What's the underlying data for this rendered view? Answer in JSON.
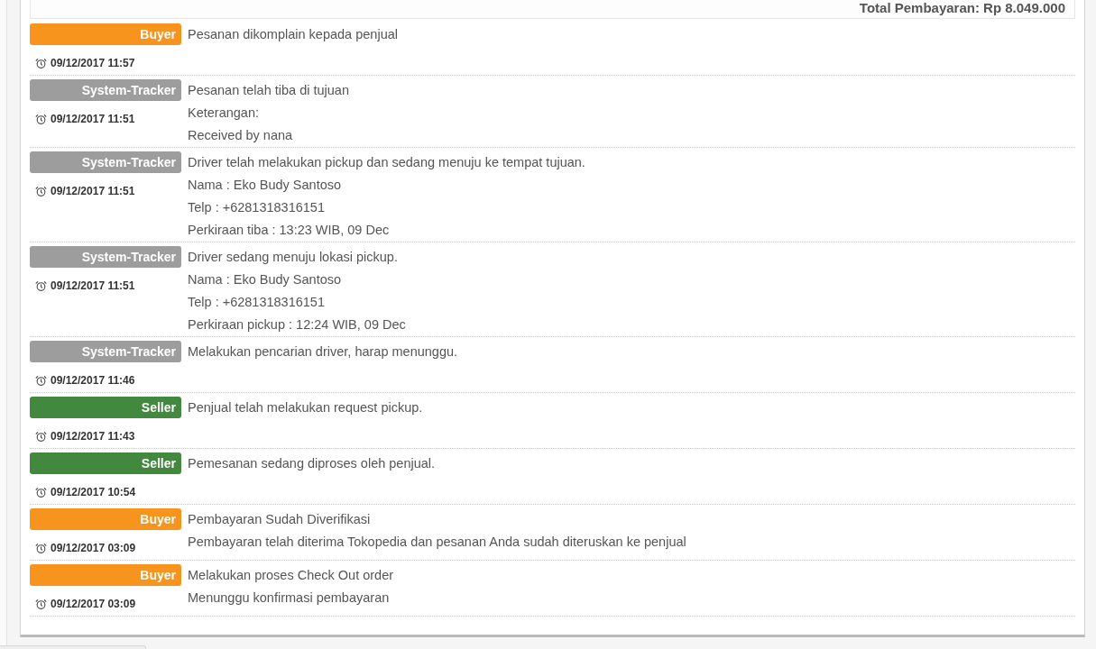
{
  "summary": {
    "total": "Total Pembayaran: Rp 8.049.000"
  },
  "history": [
    {
      "actor": "Buyer",
      "color": "#f7941d",
      "time": "09/12/2017 11:57",
      "lines": [
        "Pesanan dikomplain kepada penjual"
      ]
    },
    {
      "actor": "System-Tracker",
      "color": "#9d9d9d",
      "time": "09/12/2017 11:51",
      "lines": [
        "Pesanan telah tiba di tujuan",
        "Keterangan:",
        "Received by nana"
      ]
    },
    {
      "actor": "System-Tracker",
      "color": "#9d9d9d",
      "time": "09/12/2017 11:51",
      "lines": [
        "Driver telah melakukan pickup dan sedang menuju ke tempat tujuan.",
        "Nama : Eko Budy Santoso",
        "Telp : +6281318316151",
        "Perkiraan tiba : 13:23 WIB, 09 Dec"
      ]
    },
    {
      "actor": "System-Tracker",
      "color": "#9d9d9d",
      "time": "09/12/2017 11:51",
      "lines": [
        "Driver sedang menuju lokasi pickup.",
        "Nama : Eko Budy Santoso",
        "Telp : +6281318316151",
        "Perkiraan pickup : 12:24 WIB, 09 Dec"
      ]
    },
    {
      "actor": "System-Tracker",
      "color": "#9d9d9d",
      "time": "09/12/2017 11:46",
      "lines": [
        "Melakukan pencarian driver, harap menunggu."
      ]
    },
    {
      "actor": "Seller",
      "color": "#42883f",
      "time": "09/12/2017 11:43",
      "lines": [
        "Penjual telah melakukan request pickup."
      ]
    },
    {
      "actor": "Seller",
      "color": "#42883f",
      "time": "09/12/2017 10:54",
      "lines": [
        "Pemesanan sedang diproses oleh penjual."
      ]
    },
    {
      "actor": "Buyer",
      "color": "#f7941d",
      "time": "09/12/2017 03:09",
      "lines": [
        "Pembayaran Sudah Diverifikasi",
        "Pembayaran telah diterima Tokopedia dan pesanan Anda sudah diteruskan ke penjual"
      ]
    },
    {
      "actor": "Buyer",
      "color": "#f7941d",
      "time": "09/12/2017 03:09",
      "lines": [
        "Melakukan proses Check Out order",
        "Menunggu konfirmasi pembayaran"
      ]
    }
  ]
}
